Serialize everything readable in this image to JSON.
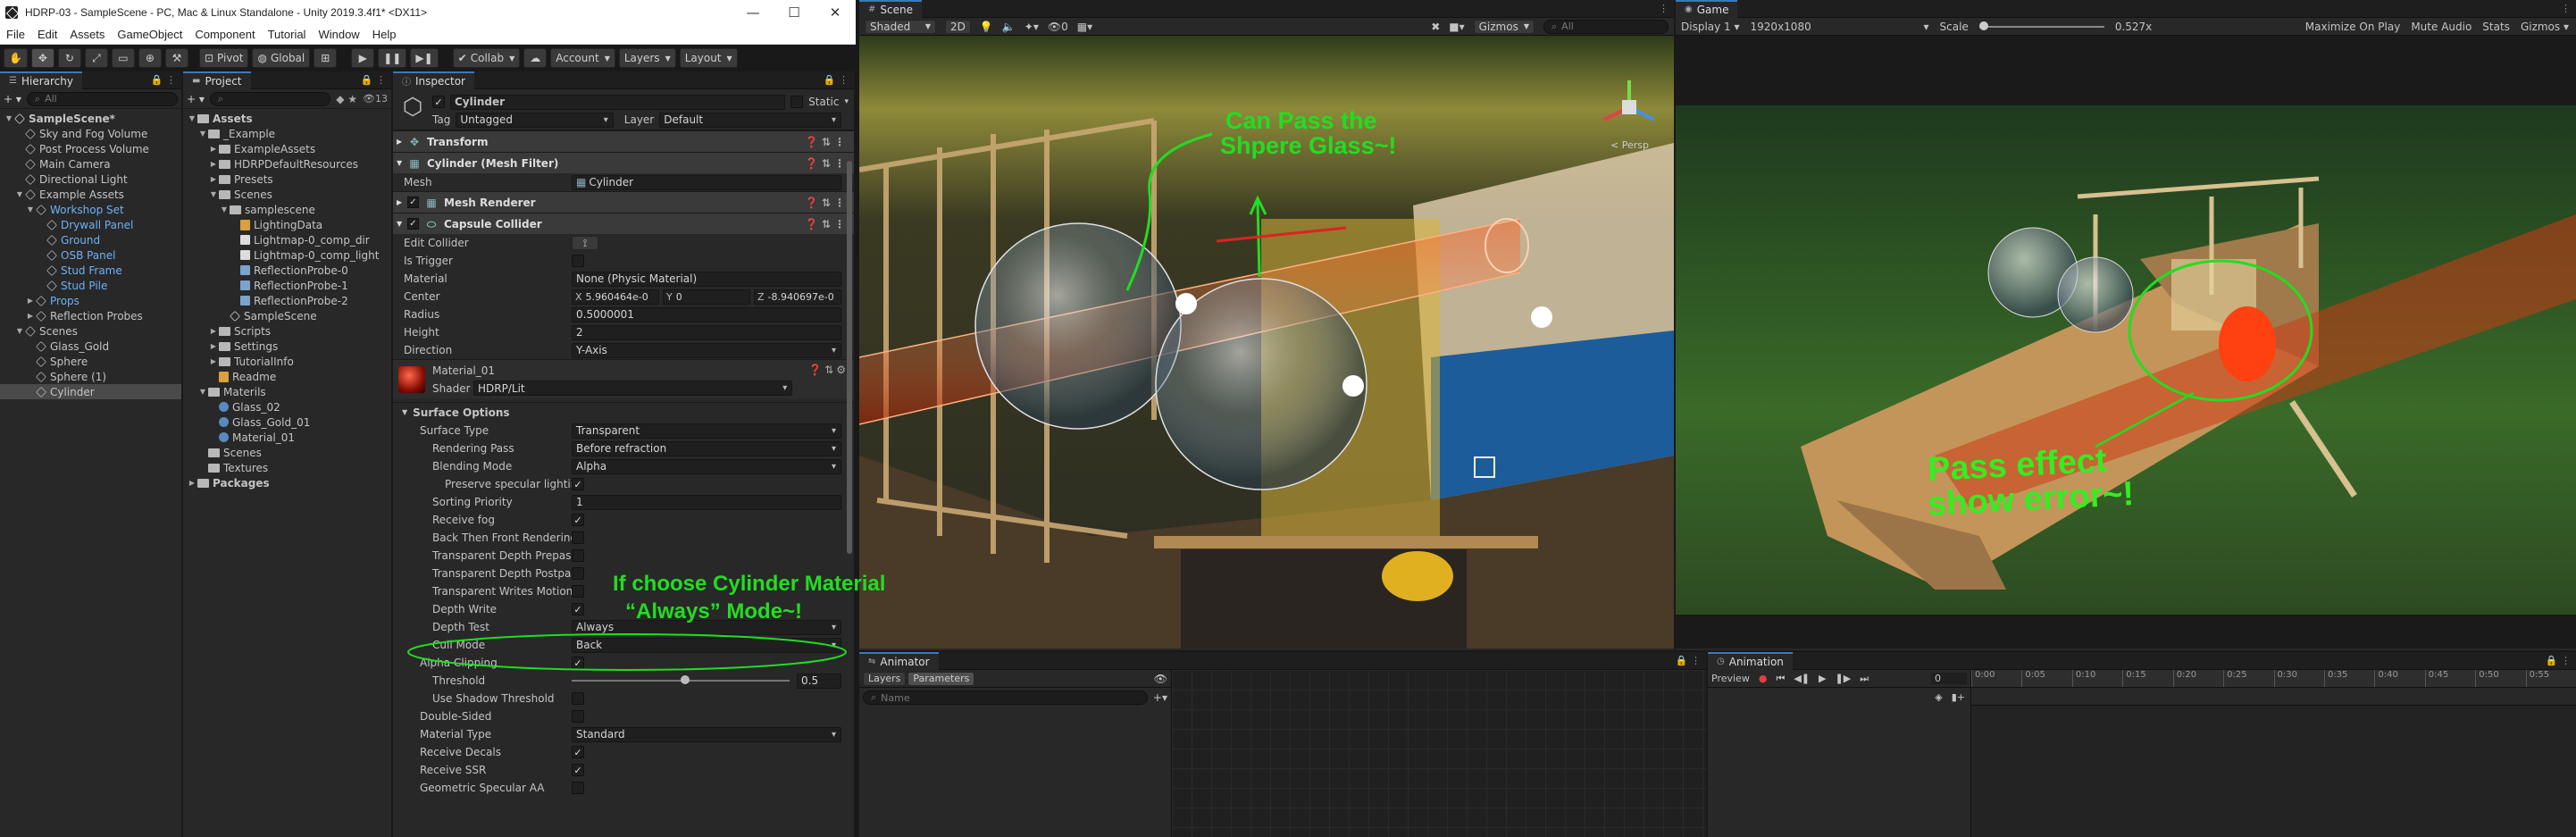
{
  "window": {
    "title": "HDRP-03 - SampleScene - PC, Mac & Linux Standalone - Unity 2019.3.4f1* <DX11>"
  },
  "menu": [
    "File",
    "Edit",
    "Assets",
    "GameObject",
    "Component",
    "Tutorial",
    "Window",
    "Help"
  ],
  "toolbar": {
    "pivot": "Pivot",
    "global": "Global",
    "collab": "Collab",
    "account": "Account",
    "layers": "Layers",
    "layout": "Layout"
  },
  "hierarchy": {
    "tab": "Hierarchy",
    "search": "All",
    "items": [
      {
        "label": "SampleScene*",
        "depth": 0,
        "arrow": "▼",
        "kind": "scene",
        "bold": true
      },
      {
        "label": "Sky and Fog Volume",
        "depth": 1,
        "arrow": "",
        "kind": "go"
      },
      {
        "label": "Post Process Volume",
        "depth": 1,
        "arrow": "",
        "kind": "go"
      },
      {
        "label": "Main Camera",
        "depth": 1,
        "arrow": "",
        "kind": "go"
      },
      {
        "label": "Directional Light",
        "depth": 1,
        "arrow": "",
        "kind": "go"
      },
      {
        "label": "Example Assets",
        "depth": 1,
        "arrow": "▼",
        "kind": "go"
      },
      {
        "label": "Workshop Set",
        "depth": 2,
        "arrow": "▼",
        "kind": "go",
        "blue": true
      },
      {
        "label": "Drywall Panel",
        "depth": 3,
        "arrow": "",
        "kind": "go",
        "blue": true
      },
      {
        "label": "Ground",
        "depth": 3,
        "arrow": "",
        "kind": "go",
        "blue": true
      },
      {
        "label": "OSB Panel",
        "depth": 3,
        "arrow": "",
        "kind": "go",
        "blue": true
      },
      {
        "label": "Stud Frame",
        "depth": 3,
        "arrow": "",
        "kind": "go",
        "blue": true
      },
      {
        "label": "Stud Pile",
        "depth": 3,
        "arrow": "",
        "kind": "go",
        "blue": true
      },
      {
        "label": "Props",
        "depth": 2,
        "arrow": "▶",
        "kind": "go",
        "blue": true
      },
      {
        "label": "Reflection Probes",
        "depth": 2,
        "arrow": "▶",
        "kind": "go"
      },
      {
        "label": "Scenes",
        "depth": 1,
        "arrow": "▼",
        "kind": "go"
      },
      {
        "label": "Glass_Gold",
        "depth": 2,
        "arrow": "",
        "kind": "go"
      },
      {
        "label": "Sphere",
        "depth": 2,
        "arrow": "",
        "kind": "go"
      },
      {
        "label": "Sphere (1)",
        "depth": 2,
        "arrow": "",
        "kind": "go"
      },
      {
        "label": "Cylinder",
        "depth": 2,
        "arrow": "",
        "kind": "go",
        "hl": true
      }
    ]
  },
  "project": {
    "tab": "Project",
    "count": "13",
    "items": [
      {
        "label": "Assets",
        "depth": 0,
        "arrow": "▼",
        "kind": "folder",
        "bold": true
      },
      {
        "label": "_Example",
        "depth": 1,
        "arrow": "▼",
        "kind": "folder"
      },
      {
        "label": "ExampleAssets",
        "depth": 2,
        "arrow": "▶",
        "kind": "folder"
      },
      {
        "label": "HDRPDefaultResources",
        "depth": 2,
        "arrow": "▶",
        "kind": "folder"
      },
      {
        "label": "Presets",
        "depth": 2,
        "arrow": "▶",
        "kind": "folder"
      },
      {
        "label": "Scenes",
        "depth": 2,
        "arrow": "▼",
        "kind": "folder"
      },
      {
        "label": "samplescene",
        "depth": 3,
        "arrow": "▼",
        "kind": "folder"
      },
      {
        "label": "LightingData",
        "depth": 4,
        "arrow": "",
        "kind": "asset"
      },
      {
        "label": "Lightmap-0_comp_dir",
        "depth": 4,
        "arrow": "",
        "kind": "tex"
      },
      {
        "label": "Lightmap-0_comp_light",
        "depth": 4,
        "arrow": "",
        "kind": "tex"
      },
      {
        "label": "ReflectionProbe-0",
        "depth": 4,
        "arrow": "",
        "kind": "probe"
      },
      {
        "label": "ReflectionProbe-1",
        "depth": 4,
        "arrow": "",
        "kind": "probe"
      },
      {
        "label": "ReflectionProbe-2",
        "depth": 4,
        "arrow": "",
        "kind": "probe"
      },
      {
        "label": "SampleScene",
        "depth": 3,
        "arrow": "",
        "kind": "scene"
      },
      {
        "label": "Scripts",
        "depth": 2,
        "arrow": "▶",
        "kind": "folder"
      },
      {
        "label": "Settings",
        "depth": 2,
        "arrow": "▶",
        "kind": "folder"
      },
      {
        "label": "TutorialInfo",
        "depth": 2,
        "arrow": "▶",
        "kind": "folder"
      },
      {
        "label": "Readme",
        "depth": 2,
        "arrow": "",
        "kind": "asset"
      },
      {
        "label": "Materils",
        "depth": 1,
        "arrow": "▼",
        "kind": "folder"
      },
      {
        "label": "Glass_02",
        "depth": 2,
        "arrow": "",
        "kind": "mat"
      },
      {
        "label": "Glass_Gold_01",
        "depth": 2,
        "arrow": "",
        "kind": "mat"
      },
      {
        "label": "Material_01",
        "depth": 2,
        "arrow": "",
        "kind": "mat"
      },
      {
        "label": "Scenes",
        "depth": 1,
        "arrow": "",
        "kind": "folder"
      },
      {
        "label": "Textures",
        "depth": 1,
        "arrow": "",
        "kind": "folder"
      },
      {
        "label": "Packages",
        "depth": 0,
        "arrow": "▶",
        "kind": "folder",
        "bold": true
      }
    ]
  },
  "inspector": {
    "tab": "Inspector",
    "object_name": "Cylinder",
    "static": "Static",
    "tag_label": "Tag",
    "tag": "Untagged",
    "layer_label": "Layer",
    "layer": "Default",
    "transform": "Transform",
    "mesh_filter": "Cylinder (Mesh Filter)",
    "mesh_label": "Mesh",
    "mesh": "Cylinder",
    "mesh_renderer": "Mesh Renderer",
    "capsule": "Capsule Collider",
    "collider": [
      {
        "label": "Edit Collider",
        "type": "edit"
      },
      {
        "label": "Is Trigger",
        "type": "check",
        "value": ""
      },
      {
        "label": "Material",
        "type": "obj",
        "value": "None (Physic Material)"
      },
      {
        "label": "Center",
        "type": "xyz",
        "x": "5.960464e-0",
        "y": "0",
        "z": "-8.940697e-0"
      },
      {
        "label": "Radius",
        "type": "field",
        "value": "0.5000001"
      },
      {
        "label": "Height",
        "type": "field",
        "value": "2"
      },
      {
        "label": "Direction",
        "type": "dd",
        "value": "Y-Axis"
      }
    ],
    "material_name": "Material_01",
    "shader_label": "Shader",
    "shader": "HDRP/Lit",
    "surface_options": "Surface Options",
    "surface": [
      {
        "label": "Surface Type",
        "type": "dd",
        "value": "Transparent",
        "ind": 0
      },
      {
        "label": "Rendering Pass",
        "type": "dd",
        "value": "Before refraction",
        "ind": 1
      },
      {
        "label": "Blending Mode",
        "type": "dd",
        "value": "Alpha",
        "ind": 1
      },
      {
        "label": "Preserve specular lighting",
        "type": "check",
        "value": "✓",
        "ind": 2
      },
      {
        "label": "Sorting Priority",
        "type": "field",
        "value": "1",
        "ind": 1
      },
      {
        "label": "Receive fog",
        "type": "check",
        "value": "✓",
        "ind": 1
      },
      {
        "label": "Back Then Front Rendering",
        "type": "check",
        "value": "",
        "ind": 1
      },
      {
        "label": "Transparent Depth Prepass",
        "type": "check",
        "value": "",
        "ind": 1
      },
      {
        "label": "Transparent Depth Postpass",
        "type": "check",
        "value": "",
        "ind": 1
      },
      {
        "label": "Transparent Writes Motion Ve",
        "type": "check",
        "value": "",
        "ind": 1
      },
      {
        "label": "Depth Write",
        "type": "check",
        "value": "✓",
        "ind": 1
      },
      {
        "label": "Depth Test",
        "type": "dd",
        "value": "Always",
        "ind": 1
      },
      {
        "label": "Cull Mode",
        "type": "dd",
        "value": "Back",
        "ind": 1
      },
      {
        "label": "Alpha Clipping",
        "type": "check",
        "value": "✓",
        "ind": 0
      },
      {
        "label": "Threshold",
        "type": "slider",
        "value": "0.5",
        "ind": 1
      },
      {
        "label": "Use Shadow Threshold",
        "type": "check",
        "value": "",
        "ind": 1
      },
      {
        "label": "Double-Sided",
        "type": "check",
        "value": "",
        "ind": 0
      },
      {
        "label": "Material Type",
        "type": "dd",
        "value": "Standard",
        "ind": 0
      },
      {
        "label": "Receive Decals",
        "type": "check",
        "value": "✓",
        "ind": 0
      },
      {
        "label": "Receive SSR",
        "type": "check",
        "value": "✓",
        "ind": 0
      },
      {
        "label": "Geometric Specular AA",
        "type": "check",
        "value": "",
        "ind": 0
      }
    ]
  },
  "scene": {
    "tab": "Scene",
    "shading": "Shaded",
    "mode2d": "2D",
    "gizmos": "Gizmos",
    "search": "All",
    "persp": "< Persp"
  },
  "game": {
    "tab": "Game",
    "display": "Display 1",
    "resolution": "1920x1080",
    "scale_label": "Scale",
    "scale": "0.527x",
    "maximize": "Maximize On Play",
    "mute": "Mute Audio",
    "stats": "Stats",
    "gizmos": "Gizmos"
  },
  "animator": {
    "tab": "Animator",
    "layers": "Layers",
    "parameters": "Parameters",
    "search": "Name"
  },
  "animation": {
    "tab": "Animation",
    "preview": "Preview",
    "frame": "0",
    "ticks": [
      "0:00",
      "0:05",
      "0:10",
      "0:15",
      "0:20",
      "0:25",
      "0:30",
      "0:35",
      "0:40",
      "0:45",
      "0:50",
      "0:55"
    ]
  },
  "annotations": {
    "scene_note_1": "Can Pass the",
    "scene_note_2": "Shpere Glass~!",
    "game_note_1": "Pass effect",
    "game_note_2": "show error~!",
    "insp_note_1": "If choose Cylinder Material",
    "insp_note_2": "“Always”   Mode~!"
  },
  "colors": {
    "annotation": "#22dd22",
    "selection": "#2c5d87",
    "prefab": "#6fb0f5"
  }
}
